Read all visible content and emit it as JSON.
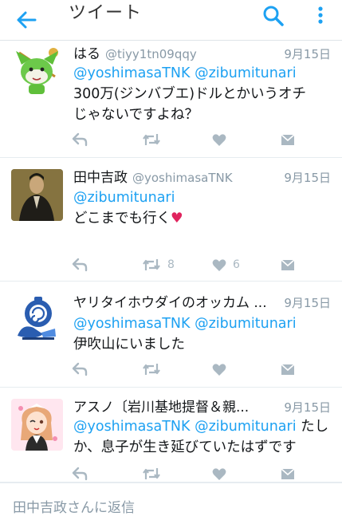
{
  "header": {
    "title": "ツイート"
  },
  "tweets": [
    {
      "name": "はる",
      "handle": "@tiyy1tn09qqy",
      "date": "9月15日",
      "lines": [
        [
          {
            "t": "@yoshimasaTNK",
            "m": true
          },
          {
            "t": " "
          },
          {
            "t": "@zibumitunari",
            "m": true
          }
        ],
        [
          {
            "t": "300万(ジンバブエ)ドルとかいうオチ"
          }
        ],
        [
          {
            "t": "じゃないですよね？"
          }
        ]
      ],
      "retweets": "",
      "likes": ""
    },
    {
      "name": "田中吉政",
      "handle": "@yoshimasaTNK",
      "date": "9月15日",
      "lines": [
        [
          {
            "t": "@zibumitunari",
            "m": true
          }
        ],
        [
          {
            "t": " "
          }
        ],
        [
          {
            "t": "どこまでも行く"
          },
          {
            "t": "♥",
            "heart": true
          }
        ]
      ],
      "retweets": "8",
      "likes": "6"
    },
    {
      "name": "ヤリタイホウダイのオッカム ...",
      "handle": "",
      "date": "9月15日",
      "lines": [
        [
          {
            "t": "@yoshimasaTNK",
            "m": true
          },
          {
            "t": " "
          },
          {
            "t": "@zibumitunari",
            "m": true
          }
        ],
        [
          {
            "t": "伊吹山にいました"
          }
        ]
      ],
      "retweets": "",
      "likes": ""
    },
    {
      "name": "アスノ〔岩川基地提督＆親...",
      "handle": "",
      "date": "9月15日",
      "lines": [
        [
          {
            "t": "@yoshimasaTNK",
            "m": true
          },
          {
            "t": " "
          },
          {
            "t": "@zibumitunari",
            "m": true
          },
          {
            "t": " たし"
          }
        ],
        [
          {
            "t": "か、息子が生き延びていたはずです"
          }
        ]
      ],
      "retweets": "",
      "likes": ""
    }
  ],
  "reply_bar": {
    "placeholder": "田中吉政さんに返信"
  },
  "colors": {
    "accent": "#1da1f2",
    "muted": "#8899a6",
    "heart": "#e0245e"
  }
}
